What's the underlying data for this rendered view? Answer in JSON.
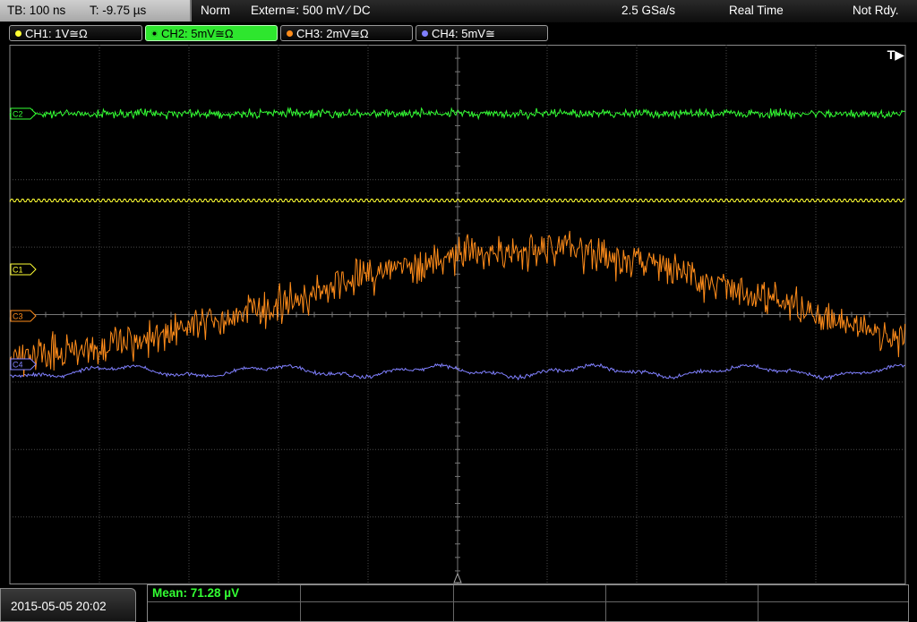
{
  "header": {
    "timebase": "TB: 100 ns",
    "trigger_time": "T: -9.75 µs",
    "trigger_mode": "Norm",
    "trigger_source": "Extern≅: 500 mV ⁄ DC",
    "sample_rate": "2.5 GSa/s",
    "acquisition_mode": "Real Time",
    "status": "Not Rdy."
  },
  "channels": [
    {
      "id": "ch1",
      "label": "CH1: 1V≅Ω",
      "color": "#ffff33",
      "marker": "C1",
      "active": false
    },
    {
      "id": "ch2",
      "label": "CH2: 5mV≅Ω",
      "color": "#33ff33",
      "marker": "C2",
      "active": true
    },
    {
      "id": "ch3",
      "label": "CH3: 2mV≅Ω",
      "color": "#ff8c1a",
      "marker": "C3",
      "active": false
    },
    {
      "id": "ch4",
      "label": "CH4: 5mV≅",
      "color": "#8080ff",
      "marker": "C4",
      "active": false
    }
  ],
  "plot": {
    "trigger_label": "T▶",
    "grid_color": "#4a4a4a",
    "center_line_color": "#777777"
  },
  "footer": {
    "datetime": "2015-05-05 20:02",
    "measurement": "Mean: 71.28 µV"
  }
}
